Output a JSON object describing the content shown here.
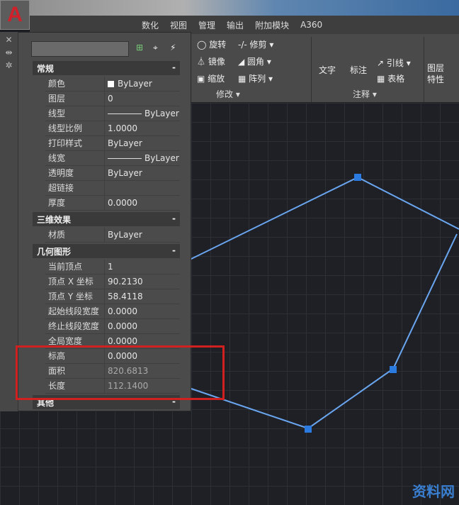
{
  "app": {
    "logo": "A"
  },
  "tabs": [
    "数化",
    "视图",
    "管理",
    "输出",
    "附加模块",
    "A360"
  ],
  "ribbon": {
    "modify": {
      "items": [
        "旋转",
        "修剪",
        "镜像",
        "圆角",
        "缩放",
        "阵列"
      ],
      "group": "修改"
    },
    "annotate": {
      "items": [
        "文字",
        "标注",
        "引线",
        "表格"
      ],
      "group": "注释"
    },
    "layers": {
      "item": "图层特性"
    }
  },
  "properties": {
    "sections": [
      {
        "title": "常规",
        "rows": [
          [
            "颜色",
            "ByLayer"
          ],
          [
            "图层",
            "0"
          ],
          [
            "线型",
            "ByLayer"
          ],
          [
            "线型比例",
            "1.0000"
          ],
          [
            "打印样式",
            "ByLayer"
          ],
          [
            "线宽",
            "ByLayer"
          ],
          [
            "透明度",
            "ByLayer"
          ],
          [
            "超链接",
            ""
          ],
          [
            "厚度",
            "0.0000"
          ]
        ]
      },
      {
        "title": "三维效果",
        "rows": [
          [
            "材质",
            "ByLayer"
          ]
        ]
      },
      {
        "title": "几何图形",
        "rows": [
          [
            "当前顶点",
            "1"
          ],
          [
            "顶点 X 坐标",
            "90.2130"
          ],
          [
            "顶点 Y 坐标",
            "58.4118"
          ],
          [
            "起始线段宽度",
            "0.0000"
          ],
          [
            "终止线段宽度",
            "0.0000"
          ],
          [
            "全局宽度",
            "0.0000"
          ],
          [
            "标高",
            "0.0000"
          ],
          [
            "面积",
            "820.6813"
          ],
          [
            "长度",
            "112.1400"
          ]
        ]
      },
      {
        "title": "其他",
        "rows": []
      }
    ],
    "collapse": "-"
  },
  "watermark": "资料网",
  "colors": {
    "highlight": "#d02020",
    "polyline": "#4a8fe0"
  }
}
